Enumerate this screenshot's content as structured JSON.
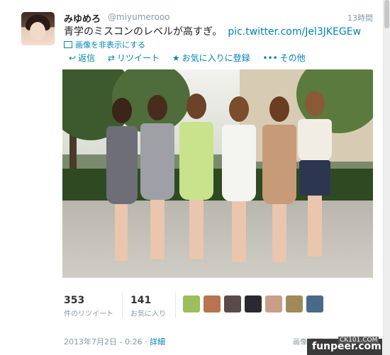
{
  "tweet": {
    "display_name": "みゆめろ",
    "handle": "@miyumerooo",
    "time": "13時間",
    "text": "青学のミスコンのレベルが高すぎ。",
    "link": "pic.twitter.com/Jel3JKEGEw",
    "hide_media": "画像を非表示にする"
  },
  "actions": {
    "reply": {
      "icon": "reply-icon",
      "label": "返信"
    },
    "retweet": {
      "icon": "retweet-icon",
      "label": "リツイート"
    },
    "favorite": {
      "icon": "star-icon",
      "label": "お気に入りに登録"
    },
    "more": {
      "icon": "more-dots-icon",
      "label": "その他"
    }
  },
  "stats": {
    "retweets_count": "353",
    "retweets_label": "件のリツイート",
    "favorites_count": "141",
    "favorites_label": "お気に入り"
  },
  "footer": {
    "date": "2013年7月2日 - 0:26",
    "separator": "·",
    "detail_link": "詳細",
    "flag_text": "画像/動画"
  },
  "watermark": {
    "small": "CK101.COM",
    "main": "funpeer.com"
  },
  "colors": {
    "link": "#0084b4",
    "muted": "#8899a6",
    "text": "#222222"
  }
}
